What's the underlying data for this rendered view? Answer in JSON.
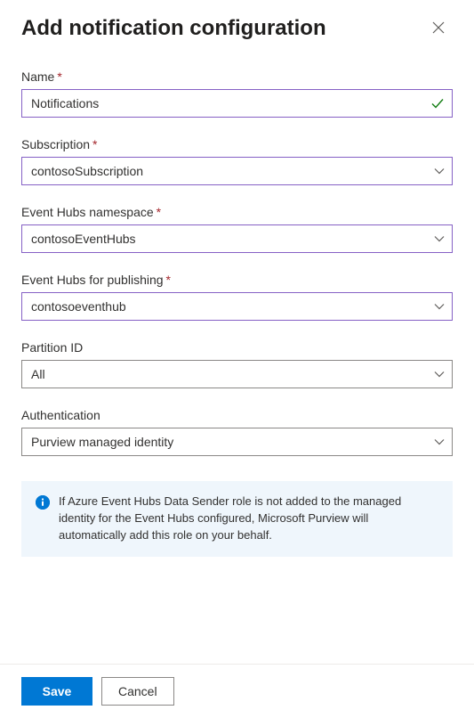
{
  "header": {
    "title": "Add notification configuration"
  },
  "fields": {
    "name": {
      "label": "Name",
      "value": "Notifications",
      "required": true,
      "validated": true
    },
    "subscription": {
      "label": "Subscription",
      "value": "contosoSubscription",
      "required": true
    },
    "namespace": {
      "label": "Event Hubs namespace",
      "value": "contosoEventHubs",
      "required": true
    },
    "publishing": {
      "label": "Event Hubs for publishing",
      "value": "contosoeventhub",
      "required": true
    },
    "partition": {
      "label": "Partition ID",
      "value": "All",
      "required": false
    },
    "authentication": {
      "label": "Authentication",
      "value": "Purview managed identity",
      "required": false
    }
  },
  "info": {
    "text": "If Azure Event Hubs Data Sender role is not added to the managed identity for the Event Hubs configured, Microsoft Purview will automatically add this role on your behalf."
  },
  "footer": {
    "save": "Save",
    "cancel": "Cancel"
  }
}
